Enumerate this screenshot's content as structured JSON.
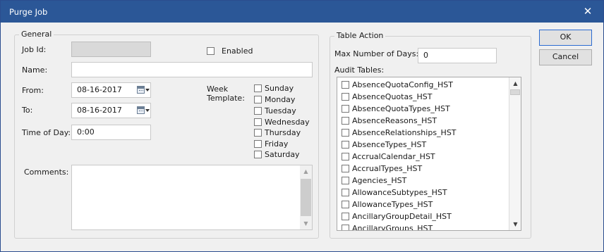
{
  "window": {
    "title": "Purge Job",
    "close_glyph": "✕"
  },
  "general": {
    "legend": "General",
    "job_id_label": "Job Id:",
    "enabled_label": "Enabled",
    "name_label": "Name:",
    "name_value": "",
    "from_label": "From:",
    "from_value": "08-16-2017",
    "to_label": "To:",
    "to_value": "08-16-2017",
    "time_label": "Time of Day:",
    "time_value": "0:00",
    "week_template_label_1": "Week",
    "week_template_label_2": "Template:",
    "weekdays": [
      "Sunday",
      "Monday",
      "Tuesday",
      "Wednesday",
      "Thursday",
      "Friday",
      "Saturday"
    ],
    "comments_label": "Comments:",
    "comments_value": ""
  },
  "table_action": {
    "legend": "Table Action",
    "max_days_label": "Max Number of Days:",
    "max_days_value": "0",
    "audit_tables_label": "Audit Tables:",
    "audit_tables": [
      "AbsenceQuotaConfig_HST",
      "AbsenceQuotas_HST",
      "AbsenceQuotaTypes_HST",
      "AbsenceReasons_HST",
      "AbsenceRelationships_HST",
      "AbsenceTypes_HST",
      "AccrualCalendar_HST",
      "AccrualTypes_HST",
      "Agencies_HST",
      "AllowanceSubtypes_HST",
      "AllowanceTypes_HST",
      "AncillaryGroupDetail_HST",
      "AncillaryGroups_HST"
    ]
  },
  "buttons": {
    "ok": "OK",
    "cancel": "Cancel"
  },
  "icons": {
    "calendar": "calendar-icon",
    "dropdown": "chevron-down-icon",
    "scroll_up": "▲",
    "scroll_down": "▼"
  },
  "colors": {
    "titlebar": "#2b5797",
    "default_button_border": "#2b6bd1",
    "dialog_background": "#f0f0f0"
  }
}
